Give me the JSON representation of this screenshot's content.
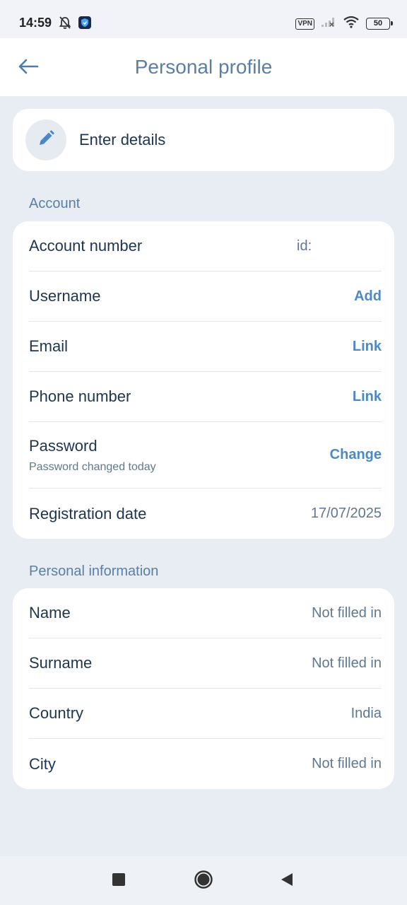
{
  "status_bar": {
    "time": "14:59",
    "vpn": "VPN",
    "battery": "50",
    "icons": [
      "bell-off-icon",
      "shield-app-icon",
      "signal-icon",
      "wifi-icon",
      "battery-icon"
    ]
  },
  "header": {
    "title": "Personal profile",
    "back_icon": "arrow-left-icon"
  },
  "enter_details": {
    "label": "Enter details",
    "icon": "pencil-icon"
  },
  "account": {
    "title": "Account",
    "rows": [
      {
        "label": "Account number",
        "value": "id:"
      },
      {
        "label": "Username",
        "action": "Add"
      },
      {
        "label": "Email",
        "action": "Link"
      },
      {
        "label": "Phone number",
        "action": "Link"
      },
      {
        "label": "Password",
        "sub": "Password changed today",
        "action": "Change"
      },
      {
        "label": "Registration date",
        "value": "17/07/2025"
      }
    ]
  },
  "personal": {
    "title": "Personal information",
    "rows": [
      {
        "label": "Name",
        "value": "Not filled in"
      },
      {
        "label": "Surname",
        "value": "Not filled in"
      },
      {
        "label": "Country",
        "value": "India"
      },
      {
        "label": "City",
        "value": "Not filled in"
      }
    ]
  },
  "nav": {
    "icons": [
      "recents-square-icon",
      "home-circle-icon",
      "back-triangle-icon"
    ]
  },
  "colors": {
    "background": "#e8ecf3",
    "accent": "#4d89c4",
    "title": "#5a7fa6",
    "text": "#1d3550"
  }
}
